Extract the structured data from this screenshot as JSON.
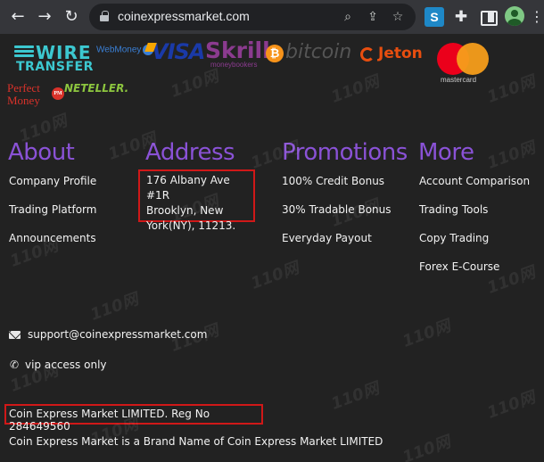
{
  "browser": {
    "back_icon": "arrow-left-icon",
    "forward_icon": "arrow-right-icon",
    "reload_icon": "reload-icon",
    "url": "coinexpressmarket.com",
    "extension_s_label": "S"
  },
  "payment_logos": {
    "wire_line1": "WIRE",
    "wire_line2": "TRANSFER",
    "webmoney": "WebMoney",
    "visa": "VISA",
    "skrill": "Skrill",
    "skrill_sub": "moneybookers",
    "bitcoin_symbol": "₿",
    "bitcoin": "bitcoin",
    "jeton": "Jeton",
    "mastercard": "mastercard",
    "perfect_line1": "Perfect",
    "perfect_line2": "Money",
    "pm_badge": "PM",
    "neteller": "NETELLER."
  },
  "footer": {
    "about": {
      "heading": "About",
      "links": [
        "Company Profile",
        "Trading Platform",
        "Announcements"
      ]
    },
    "address": {
      "heading": "Address",
      "lines": [
        "176 Albany Ave #1R",
        "Brooklyn, New",
        "York(NY), 11213."
      ]
    },
    "promotions": {
      "heading": "Promotions",
      "links": [
        "100% Credit Bonus",
        "30% Tradable Bonus",
        "Everyday Payout"
      ]
    },
    "more": {
      "heading": "More",
      "links": [
        "Account Comparison",
        "Trading Tools",
        "Copy Trading",
        "Forex E-Course"
      ]
    }
  },
  "contact": {
    "email": "support@coinexpressmarket.com",
    "phone": "vip access only"
  },
  "legal": {
    "registration": "Coin Express Market LIMITED. Reg No 284649560",
    "brand_line": "Coin Express Market is a Brand Name of Coin Express Market LIMITED"
  },
  "watermark": "110网"
}
